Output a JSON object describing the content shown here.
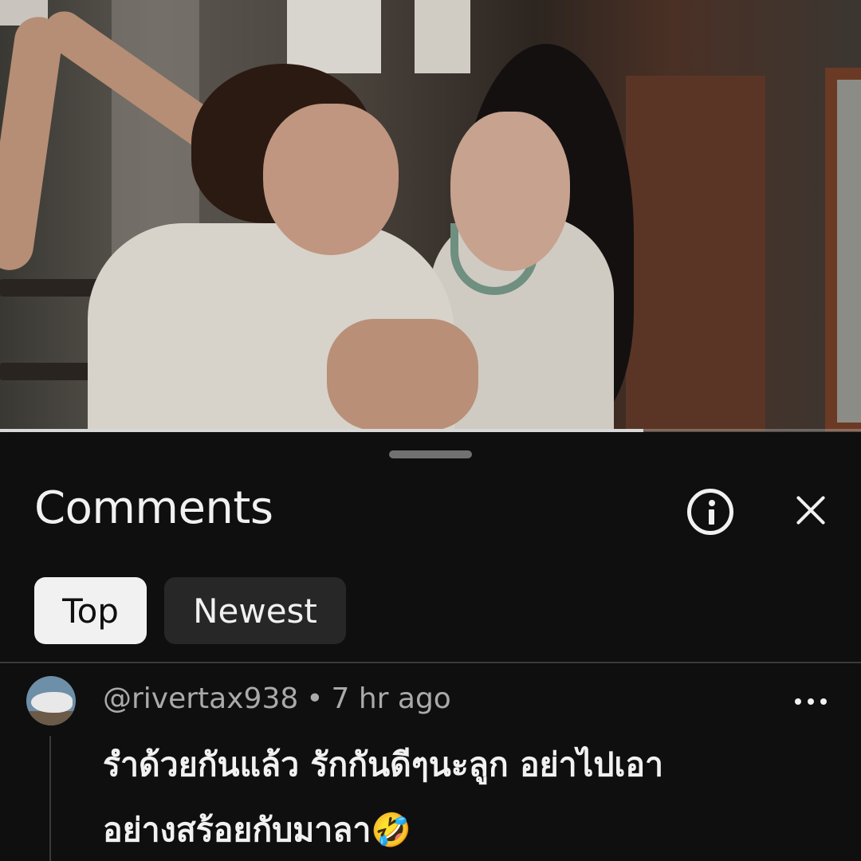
{
  "video": {
    "progress": 0.747
  },
  "comments_panel": {
    "title": "Comments",
    "info_icon": "info-circle-icon",
    "close_icon": "close-icon",
    "filters": [
      {
        "label": "Top",
        "selected": true
      },
      {
        "label": "Newest",
        "selected": false
      }
    ]
  },
  "comment": {
    "author": "@rivertax938",
    "separator": "•",
    "time": "7 hr ago",
    "text_line1": "รำด้วยกันแล้ว รักกันดีๆนะลูก อย่าไปเอา",
    "text_line2": "อย่างสร้อยกับมาลา🤣",
    "more_icon": "more-horizontal-icon"
  },
  "colors": {
    "background": "#0f0f0f",
    "text_primary": "#f1f1f1",
    "text_secondary": "#aaaaaa",
    "chip_active": "#f1f1f1",
    "chip_inactive": "#272727"
  }
}
